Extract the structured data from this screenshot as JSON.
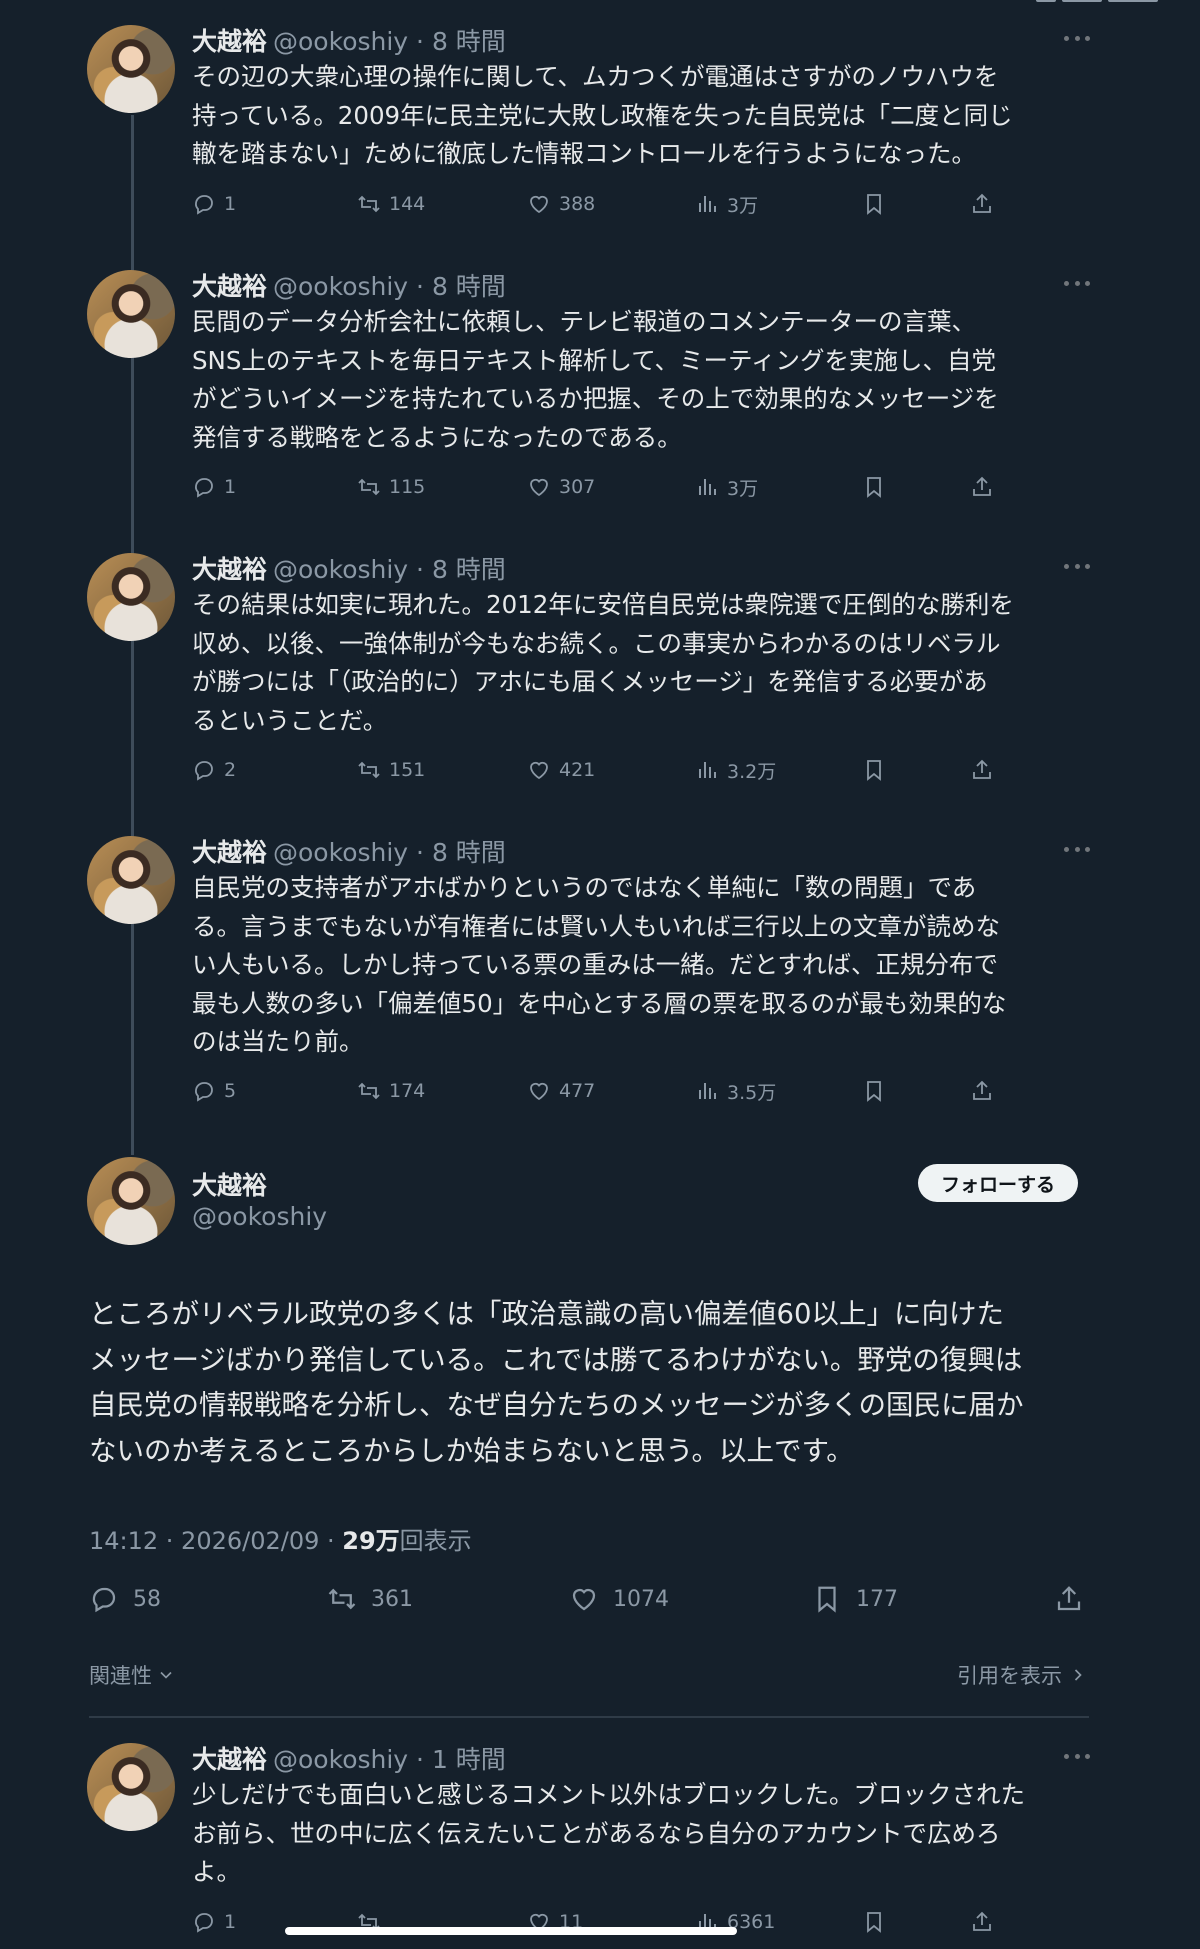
{
  "thread_tweets": [
    {
      "name": "大越裕",
      "meta": "@ookoshiy · 8 時間",
      "lines": [
        "その辺の大衆心理の操作に関して、ムカつくが電通はさすがのノウハウを",
        "持っている。2009年に民主党に大敗し政権を失った自民党は「二度と同じ",
        "轍を踏まない」ために徹底した情報コントロールを行うようになった。"
      ],
      "replies": "1",
      "retweets": "144",
      "likes": "388",
      "views": "3万"
    },
    {
      "name": "大越裕",
      "meta": "@ookoshiy · 8 時間",
      "lines": [
        "民間のデータ分析会社に依頼し、テレビ報道のコメンテーターの言葉、",
        "SNS上のテキストを毎日テキスト解析して、ミーティングを実施し、自党",
        "がどういイメージを持たれているか把握、その上で効果的なメッセージを",
        "発信する戦略をとるようになったのである。"
      ],
      "replies": "1",
      "retweets": "115",
      "likes": "307",
      "views": "3万"
    },
    {
      "name": "大越裕",
      "meta": "@ookoshiy · 8 時間",
      "lines": [
        "その結果は如実に現れた。2012年に安倍自民党は衆院選で圧倒的な勝利を",
        "収め、以後、一強体制が今もなお続く。この事実からわかるのはリベラル",
        "が勝つには「（政治的に）アホにも届くメッセージ」を発信する必要があ",
        "るということだ。"
      ],
      "replies": "2",
      "retweets": "151",
      "likes": "421",
      "views": "3.2万"
    },
    {
      "name": "大越裕",
      "meta": "@ookoshiy · 8 時間",
      "lines": [
        "自民党の支持者がアホばかりというのではなく単純に「数の問題」であ",
        "る。言うまでもないが有権者には賢い人もいれば三行以上の文章が読めな",
        "い人もいる。しかし持っている票の重みは一緒。だとすれば、正規分布で",
        "最も人数の多い「偏差値50」を中心とする層の票を取るのが最も効果的な",
        "のは当たり前。"
      ],
      "replies": "5",
      "retweets": "174",
      "likes": "477",
      "views": "3.5万"
    }
  ],
  "main_tweet": {
    "name": "大越裕",
    "handle": "@ookoshiy",
    "follow_label": "フォローする",
    "lines": [
      "ところがリベラル政党の多くは「政治意識の高い偏差値60以上」に向けた",
      "メッセージばかり発信している。これでは勝てるわけがない。野党の復興は",
      "自民党の情報戦略を分析し、なぜ自分たちのメッセージが多くの国民に届か",
      "ないのか考えるところからしか始まらないと思う。以上です。"
    ],
    "time": "14:12 · 2026/02/09 · ",
    "views_count": "29万",
    "views_label": "回表示",
    "replies": "58",
    "retweets": "361",
    "likes": "1074",
    "bookmarks": "177"
  },
  "sort_label": "関連性",
  "quotes_label": "引用を表示",
  "reply_tweet": {
    "name": "大越裕",
    "meta": "@ookoshiy · 1 時間",
    "lines": [
      "少しだけでも面白いと感じるコメント以外はブロックした。ブロックされた",
      "お前ら、世の中に広く伝えたいことがあるなら自分のアカウントで広めろ",
      "よ。"
    ],
    "replies": "1",
    "retweets": "",
    "likes": "11",
    "views": "6361"
  },
  "colors": {
    "background": "#15202b",
    "text": "#e7e9ea",
    "muted": "#8b98a5",
    "thread_line": "#3e4c5a"
  },
  "icons": [
    "reply-icon",
    "retweet-icon",
    "like-icon",
    "views-icon",
    "bookmark-icon",
    "share-icon",
    "more-icon",
    "chevron-down-icon",
    "chevron-right-icon"
  ]
}
